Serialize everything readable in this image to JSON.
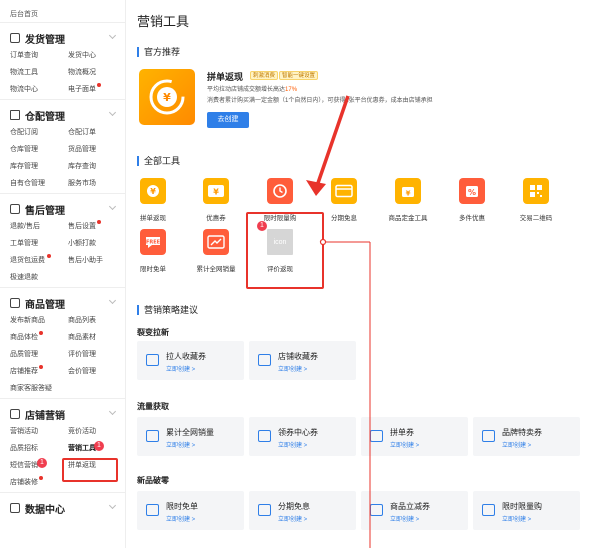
{
  "sidebar": {
    "top_item": "后台首页",
    "sections": [
      {
        "title": "发货管理",
        "items": [
          "订单查询",
          "发货中心",
          "物流工具",
          "物流概况",
          "物流中心",
          "电子面单"
        ]
      },
      {
        "title": "仓配管理",
        "items": [
          "仓配订阅",
          "仓配订单",
          "仓库管理",
          "货品管理",
          "库存管理",
          "库存查询",
          "自有仓管理",
          "服务市场"
        ]
      },
      {
        "title": "售后管理",
        "items": [
          "退款/售后",
          "售后设置",
          "工单管理",
          "小额打款",
          "退货包运费",
          "售后小助手",
          "极速退款"
        ]
      },
      {
        "title": "商品管理",
        "items": [
          "发布新商品",
          "商品列表",
          "商品体检",
          "商品素材",
          "品质管理",
          "评价管理",
          "店铺推荐",
          "会价管理",
          "商家客服答疑"
        ]
      },
      {
        "title": "店铺营销",
        "items": [
          "营销活动",
          "竞价活动",
          "品质招标",
          "营销工具",
          "短信营销",
          "拼单返现",
          "店铺装修"
        ]
      },
      {
        "title": "数据中心",
        "items": []
      }
    ],
    "badges": [
      "1",
      "1"
    ]
  },
  "main": {
    "title": "营销工具",
    "official": {
      "section_title": "官方推荐",
      "name": "拼单返现",
      "tags": [
        "刺激消费",
        "智能一键设置"
      ],
      "desc_prefix": "平均拉动店铺成交额增长高达",
      "desc_highlight": "17%",
      "desc2": "消费者累计购买满一定金额（1个自然日内），可获得1张平台优惠券，成本由店铺承担",
      "button": "去创建"
    },
    "all_tools": {
      "section_title": "全部工具",
      "items": [
        "拼单返现",
        "优惠券",
        "限时限量购",
        "分期免息",
        "商品定金工具",
        "多件优惠",
        "交易二维码",
        "限时免单",
        "累计全网销量",
        "评价返现"
      ],
      "placeholder_text": "icon",
      "badge": "1"
    },
    "strategy": {
      "section_title": "营销策略建议",
      "groups": [
        {
          "title": "裂变拉新",
          "cards": [
            {
              "name": "拉人收藏券",
              "link": "立即创建 >"
            },
            {
              "name": "店铺收藏券",
              "link": "立即创建 >"
            }
          ]
        },
        {
          "title": "流量获取",
          "cards": [
            {
              "name": "累计全网销量",
              "link": "立即创建 >"
            },
            {
              "name": "领券中心券",
              "link": "立即创建 >"
            },
            {
              "name": "拼单券",
              "link": "立即创建 >"
            },
            {
              "name": "品牌特卖券",
              "link": "立即创建 >"
            }
          ]
        },
        {
          "title": "新品破零",
          "cards": [
            {
              "name": "限时免单",
              "link": "立即创建 >"
            },
            {
              "name": "分期免息",
              "link": "立即创建 >"
            },
            {
              "name": "商品立减券",
              "link": "立即创建 >"
            },
            {
              "name": "限时限量购",
              "link": "立即创建 >"
            }
          ]
        }
      ]
    }
  },
  "colors": {
    "accent": "#2f7fe8",
    "annotation": "#e8332b",
    "orange": "#ff8a00"
  }
}
